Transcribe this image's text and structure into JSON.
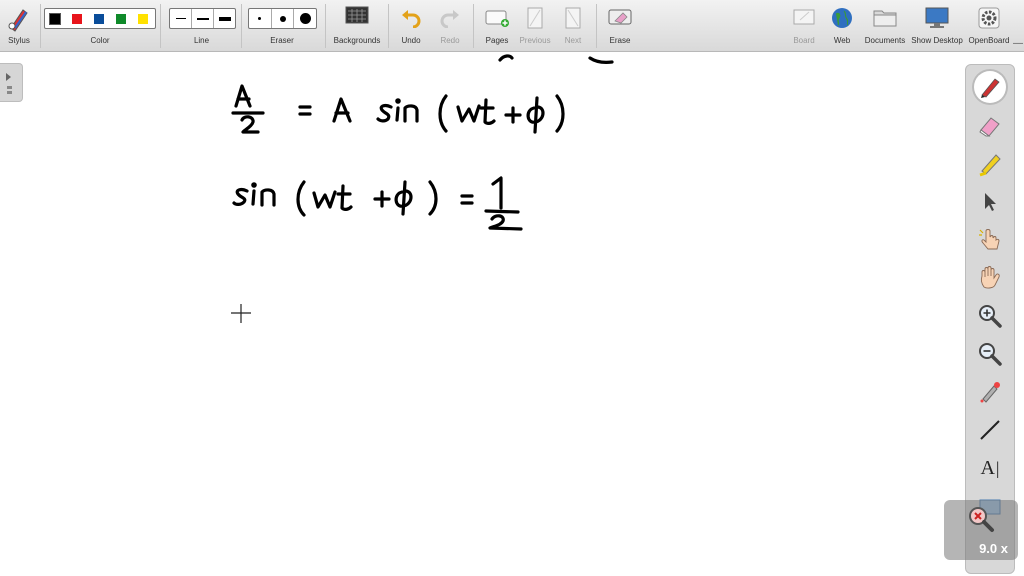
{
  "toolbar": {
    "stylus_label": "Stylus",
    "color_label": "Color",
    "line_label": "Line",
    "eraser_label": "Eraser",
    "backgrounds_label": "Backgrounds",
    "undo_label": "Undo",
    "redo_label": "Redo",
    "pages_label": "Pages",
    "previous_label": "Previous",
    "next_label": "Next",
    "erase_label": "Erase",
    "board_label": "Board",
    "web_label": "Web",
    "documents_label": "Documents",
    "show_desktop_label": "Show Desktop",
    "openboard_label": "OpenBoard",
    "colors": [
      "#000000",
      "#e8141b",
      "#0a4d9a",
      "#0f8a2a",
      "#ffe100"
    ],
    "selected_color": "#000000"
  },
  "zoom": {
    "value": "9.0 x"
  },
  "palette": {
    "tools": [
      "pen-icon",
      "eraser-icon",
      "marker-icon",
      "selector-icon",
      "interactor-icon",
      "hand-icon",
      "zoom-in-icon",
      "zoom-out-icon",
      "laser-pointer-icon",
      "line-icon",
      "text-icon",
      "capture-icon"
    ],
    "text_tool_glyph": "A"
  }
}
